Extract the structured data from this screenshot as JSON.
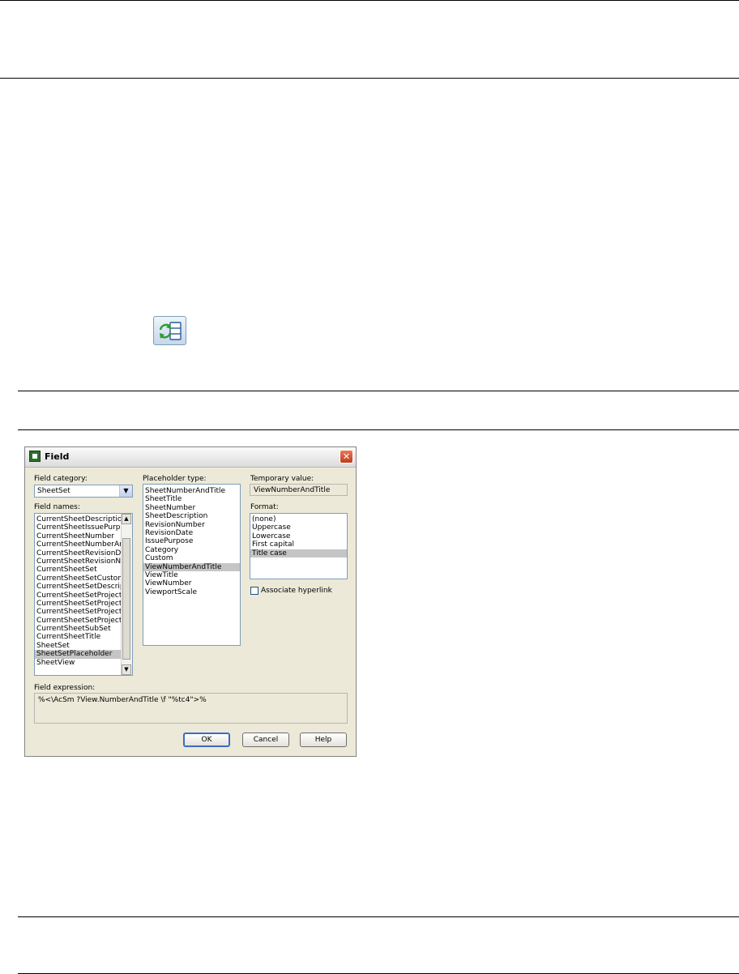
{
  "toolbar_icon": {
    "icon": "update-fields-icon"
  },
  "dialog": {
    "title": "Field",
    "close_symbol": "✕",
    "field_category": {
      "label": "Field category:",
      "value": "SheetSet"
    },
    "field_names": {
      "label": "Field names:",
      "items": [
        "CurrentSheetDescription",
        "CurrentSheetIssuePurpose",
        "CurrentSheetNumber",
        "CurrentSheetNumberAndTitle",
        "CurrentSheetRevisionDate",
        "CurrentSheetRevisionNumber",
        "CurrentSheetSet",
        "CurrentSheetSetCustom",
        "CurrentSheetSetDescription",
        "CurrentSheetSetProjectMilestone",
        "CurrentSheetSetProjectName",
        "CurrentSheetSetProjectNumber",
        "CurrentSheetSetProjectPhase",
        "CurrentSheetSubSet",
        "CurrentSheetTitle",
        "SheetSet",
        "SheetSetPlaceholder",
        "SheetView"
      ],
      "selected": "SheetSetPlaceholder"
    },
    "placeholder_type": {
      "label": "Placeholder type:",
      "items": [
        "SheetNumberAndTitle",
        "SheetTitle",
        "SheetNumber",
        "SheetDescription",
        "RevisionNumber",
        "RevisionDate",
        "IssuePurpose",
        "Category",
        "Custom",
        "ViewNumberAndTitle",
        "ViewTitle",
        "ViewNumber",
        "ViewportScale"
      ],
      "selected": "ViewNumberAndTitle"
    },
    "temporary_value": {
      "label": "Temporary value:",
      "value": "ViewNumberAndTitle"
    },
    "format": {
      "label": "Format:",
      "items": [
        "(none)",
        "Uppercase",
        "Lowercase",
        "First capital",
        "Title case"
      ],
      "selected": "Title case"
    },
    "associate_hyperlink": {
      "label": "Associate hyperlink",
      "checked": false
    },
    "field_expression": {
      "label": "Field expression:",
      "value": "%<\\AcSm ?View.NumberAndTitle \\f \"%tc4\">%"
    },
    "buttons": {
      "ok": "OK",
      "cancel": "Cancel",
      "help": "Help"
    }
  }
}
